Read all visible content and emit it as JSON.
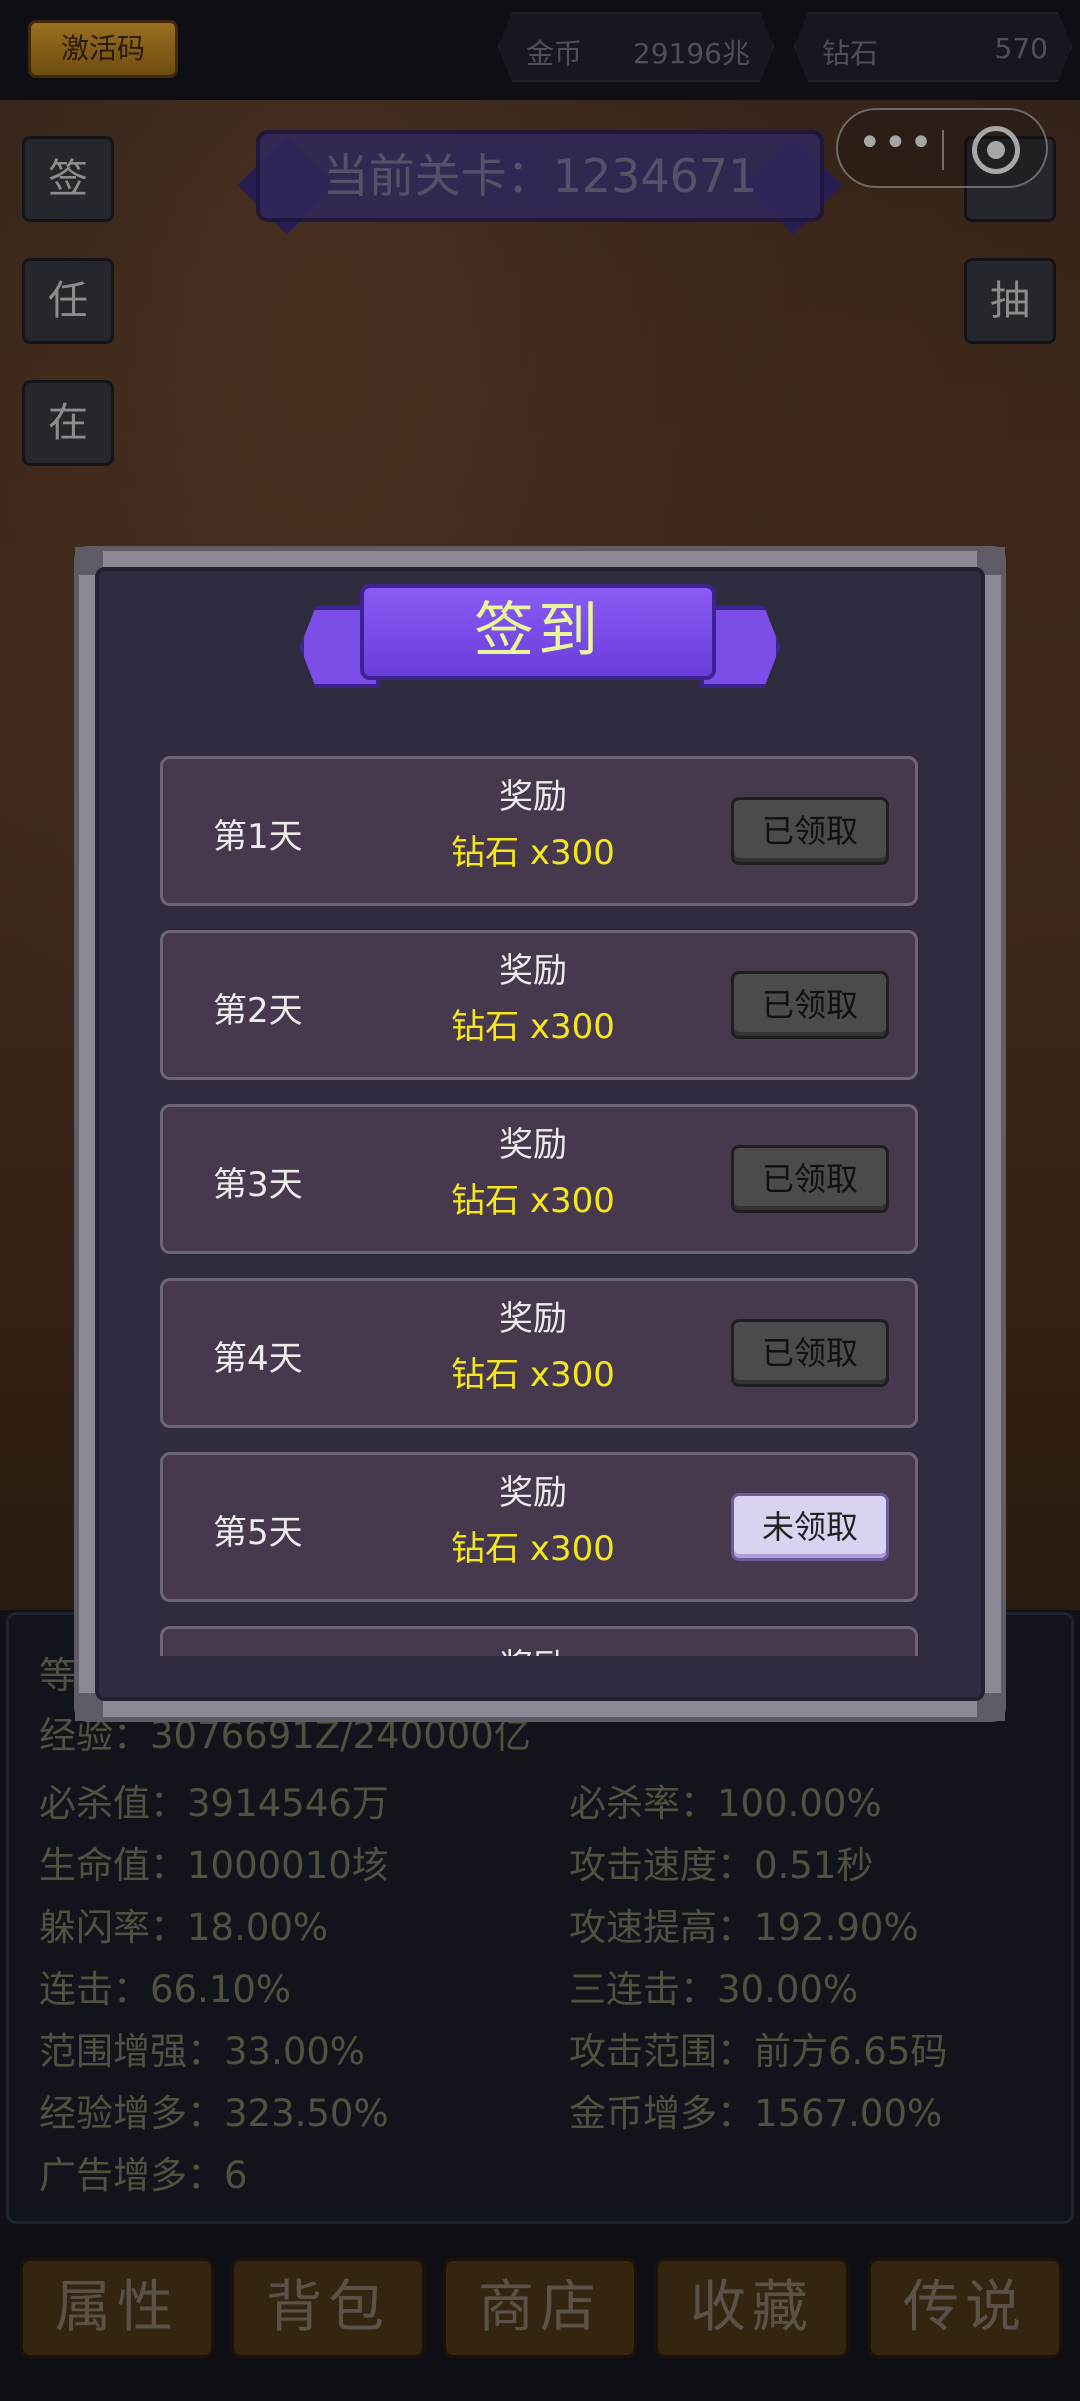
{
  "topbar": {
    "activation_label": "激活码",
    "gold_label": "金币",
    "gold_value": "29196兆",
    "diamond_label": "钻石",
    "diamond_value": "570"
  },
  "scene": {
    "level_text": "当前关卡：1234671",
    "side_buttons": [
      "签",
      "任",
      "在"
    ],
    "right_buttons": [
      "抽"
    ]
  },
  "modal": {
    "title": "签到",
    "rows": [
      {
        "day": "第1天",
        "reward_label": "奖励",
        "reward": "钻石 x300",
        "button": "已领取",
        "claimed": true
      },
      {
        "day": "第2天",
        "reward_label": "奖励",
        "reward": "钻石 x300",
        "button": "已领取",
        "claimed": true
      },
      {
        "day": "第3天",
        "reward_label": "奖励",
        "reward": "钻石 x300",
        "button": "已领取",
        "claimed": true
      },
      {
        "day": "第4天",
        "reward_label": "奖励",
        "reward": "钻石 x300",
        "button": "已领取",
        "claimed": true
      },
      {
        "day": "第5天",
        "reward_label": "奖励",
        "reward": "钻石 x300",
        "button": "未领取",
        "claimed": false
      },
      {
        "reward_label": "奖励"
      }
    ]
  },
  "stats": {
    "level_label_partial": "等",
    "exp": "经验：3076691Z/240000亿",
    "left": [
      "必杀值：3914546万",
      "生命值：1000010垓",
      "躲闪率：18.00%",
      "连击：66.10%",
      "范围增强：33.00%",
      "经验增多：323.50%",
      "广告增多：6"
    ],
    "right": [
      "必杀率：100.00%",
      "攻击速度：0.51秒",
      "攻速提高：192.90%",
      "三连击：30.00%",
      "攻击范围：前方6.65码",
      "金币增多：1567.00%"
    ]
  },
  "nav": [
    "属性",
    "背包",
    "商店",
    "收藏",
    "传说"
  ]
}
